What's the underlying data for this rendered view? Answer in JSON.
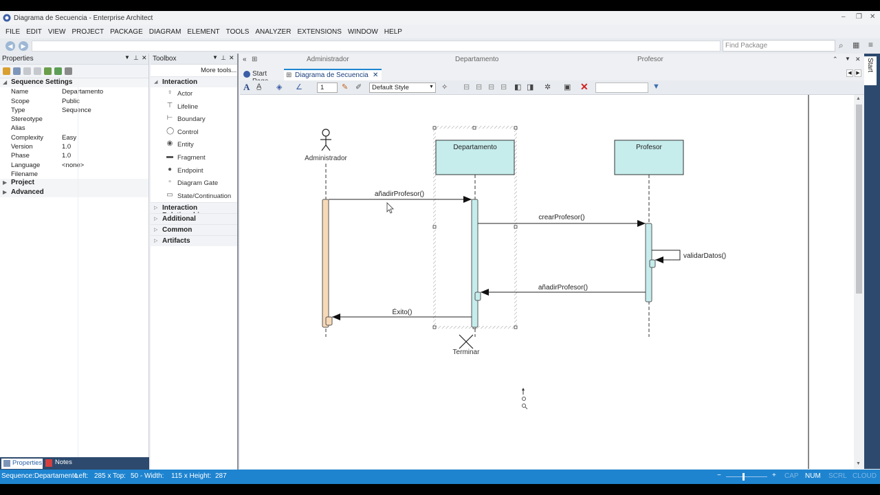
{
  "window": {
    "title": "Diagrama de Secuencia - Enterprise Architect"
  },
  "menu": [
    "FILE",
    "EDIT",
    "VIEW",
    "PROJECT",
    "PACKAGE",
    "DIAGRAM",
    "ELEMENT",
    "TOOLS",
    "ANALYZER",
    "EXTENSIONS",
    "WINDOW",
    "HELP"
  ],
  "nav": {
    "find_placeholder": "Find Package"
  },
  "properties": {
    "title": "Properties",
    "section": "Sequence Settings",
    "rows": [
      {
        "k": "Name",
        "v": "Departamento"
      },
      {
        "k": "Scope",
        "v": "Public"
      },
      {
        "k": "Type",
        "v": "Sequence"
      },
      {
        "k": "Stereotype",
        "v": ""
      },
      {
        "k": "Alias",
        "v": ""
      },
      {
        "k": "Complexity",
        "v": "Easy"
      },
      {
        "k": "Version",
        "v": "1.0"
      },
      {
        "k": "Phase",
        "v": "1.0"
      },
      {
        "k": "Language",
        "v": "<none>"
      },
      {
        "k": "Filename",
        "v": ""
      }
    ],
    "collapsed": [
      "Project",
      "Advanced"
    ],
    "tabs": {
      "properties": "Properties",
      "notes": "Notes"
    }
  },
  "toolbox": {
    "title": "Toolbox",
    "more": "More tools...",
    "group": "Interaction",
    "items": [
      {
        "label": "Actor",
        "icon": "actor-icon"
      },
      {
        "label": "Lifeline",
        "icon": "lifeline-icon"
      },
      {
        "label": "Boundary",
        "icon": "boundary-icon"
      },
      {
        "label": "Control",
        "icon": "control-icon"
      },
      {
        "label": "Entity",
        "icon": "entity-icon"
      },
      {
        "label": "Fragment",
        "icon": "fragment-icon"
      },
      {
        "label": "Endpoint",
        "icon": "endpoint-icon"
      },
      {
        "label": "Diagram Gate",
        "icon": "gate-icon"
      },
      {
        "label": "State/Continuation",
        "icon": "state-icon"
      }
    ],
    "groups": [
      "Interaction Relationships",
      "Additional",
      "Common",
      "Artifacts"
    ]
  },
  "diagram": {
    "lanes": [
      "Administrador",
      "Departamento",
      "Profesor"
    ],
    "tabs": {
      "start": "Start Page",
      "current": "Diagrama de Secuencia"
    },
    "toolbar": {
      "zoom_value": "1",
      "style": "Default Style"
    },
    "actor": "Administrador",
    "lifeline1": "Departamento",
    "lifeline2": "Profesor",
    "messages": {
      "m1": "añadirProfesor()",
      "m2": "crearProfesor()",
      "m3": "validarDatos()",
      "m4": "añadirProfesor()",
      "m5": "Éxito()"
    },
    "destroy": "Terminar"
  },
  "side_tab": "Start",
  "status": {
    "element": "Sequence:Departamento",
    "left": "Left:",
    "left_val": "285 x Top:",
    "top_val": "50 - Width:",
    "width_val": "115 x Height:",
    "height_val": "287",
    "zoom_minus": "−",
    "zoom_plus": "+",
    "cap": "CAP",
    "num": "NUM",
    "scrl": "SCRL",
    "cloud": "CLOUD"
  },
  "colors": {
    "accent": "#1e84d0",
    "lifeline_fill": "#c6ecec",
    "actor_activation": "#f7d9b8",
    "dark_panel": "#2d4a6e"
  }
}
